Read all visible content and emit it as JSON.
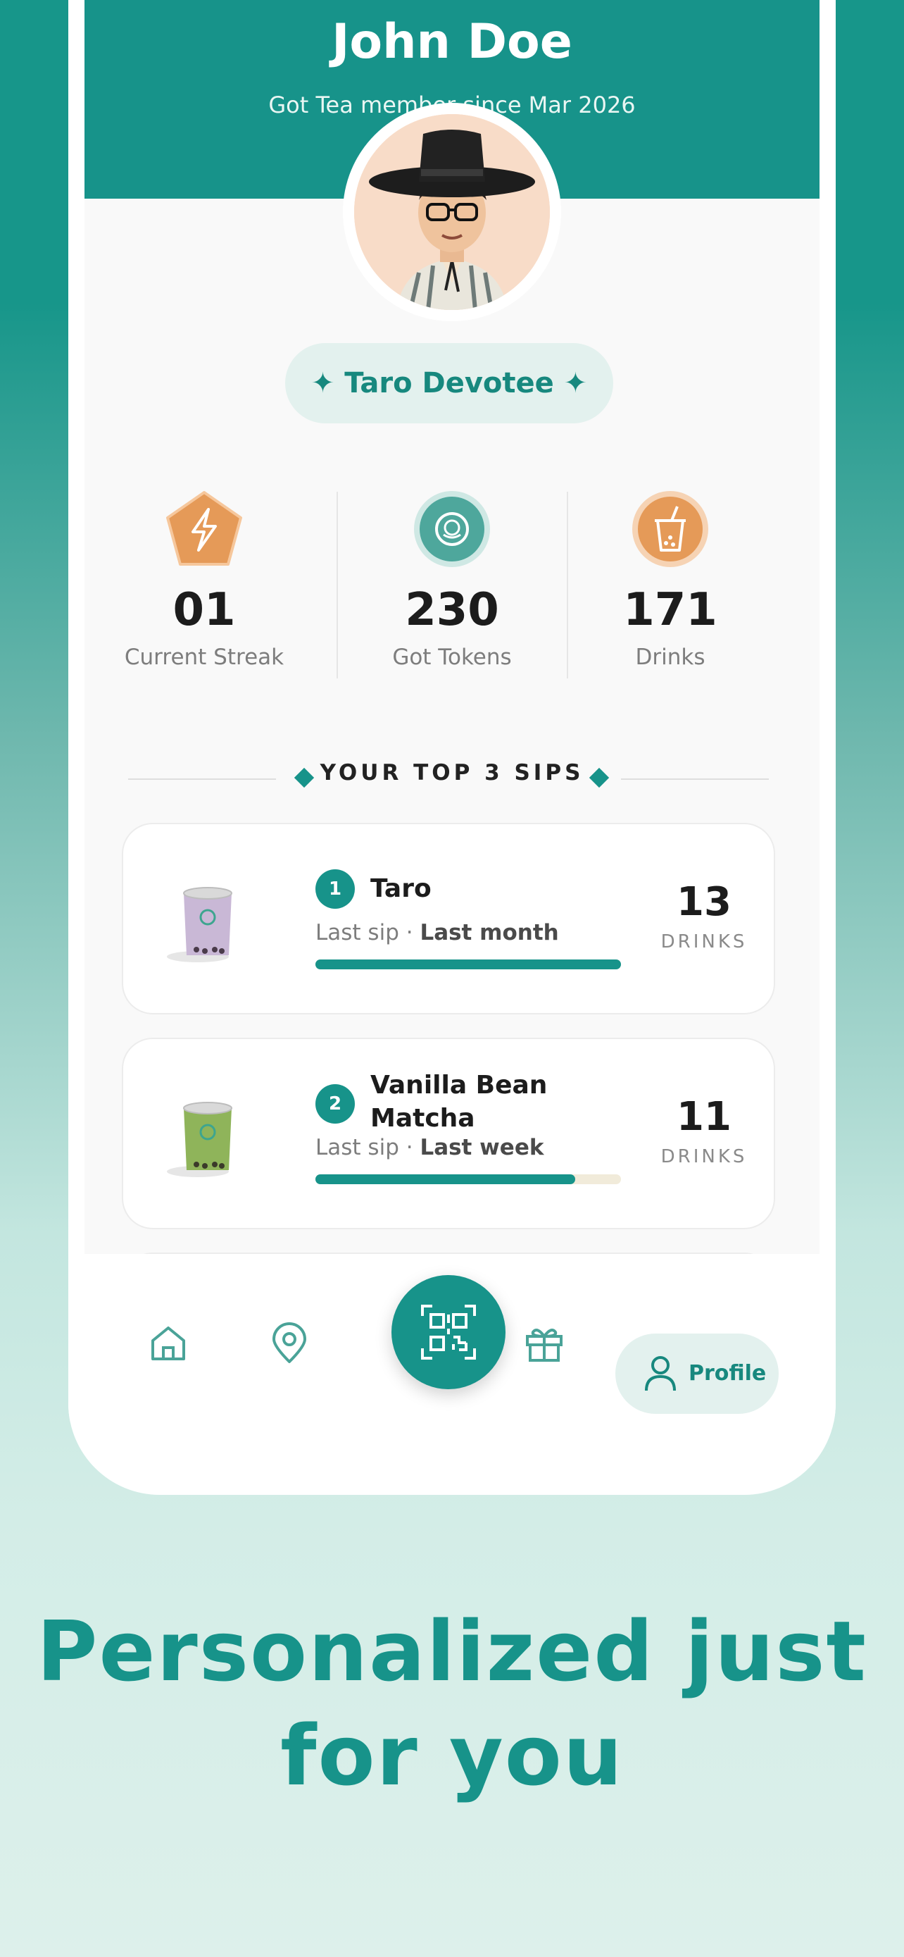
{
  "profile": {
    "name": "John Doe",
    "member_since": "Got Tea member since Mar 2026",
    "badge": "✦ Taro Devotee ✦"
  },
  "stats": [
    {
      "value": "01",
      "label": "Current Streak",
      "icon": "lightning-icon"
    },
    {
      "value": "230",
      "label": "Got Tokens",
      "icon": "token-icon"
    },
    {
      "value": "171",
      "label": "Drinks",
      "icon": "boba-cup-icon"
    }
  ],
  "top_sips": {
    "title": "YOUR TOP 3 SIPS",
    "items": [
      {
        "rank": "1",
        "name": "Taro",
        "last_sip_prefix": "Last sip · ",
        "last_sip": "Last month",
        "count": "13",
        "unit": "DRINKS",
        "progress": 1.0,
        "cup_color": "#c9b8d6"
      },
      {
        "rank": "2",
        "name_line1": "Vanilla Bean",
        "name_line2": "Matcha",
        "last_sip_prefix": "Last sip · ",
        "last_sip": "Last week",
        "count": "11",
        "unit": "DRINKS",
        "progress": 0.85,
        "cup_color": "#8fb45a"
      }
    ]
  },
  "nav": {
    "items": [
      "home-icon",
      "location-pin-icon",
      "scan-qr-icon",
      "gift-icon",
      "profile-icon"
    ],
    "profile_label": "Profile"
  },
  "colors": {
    "brand": "#17938a",
    "accent_orange": "#e59a58",
    "badge_bg": "#e3f1ee"
  },
  "tagline": {
    "line1": "Personalized just",
    "line2": "for you"
  }
}
